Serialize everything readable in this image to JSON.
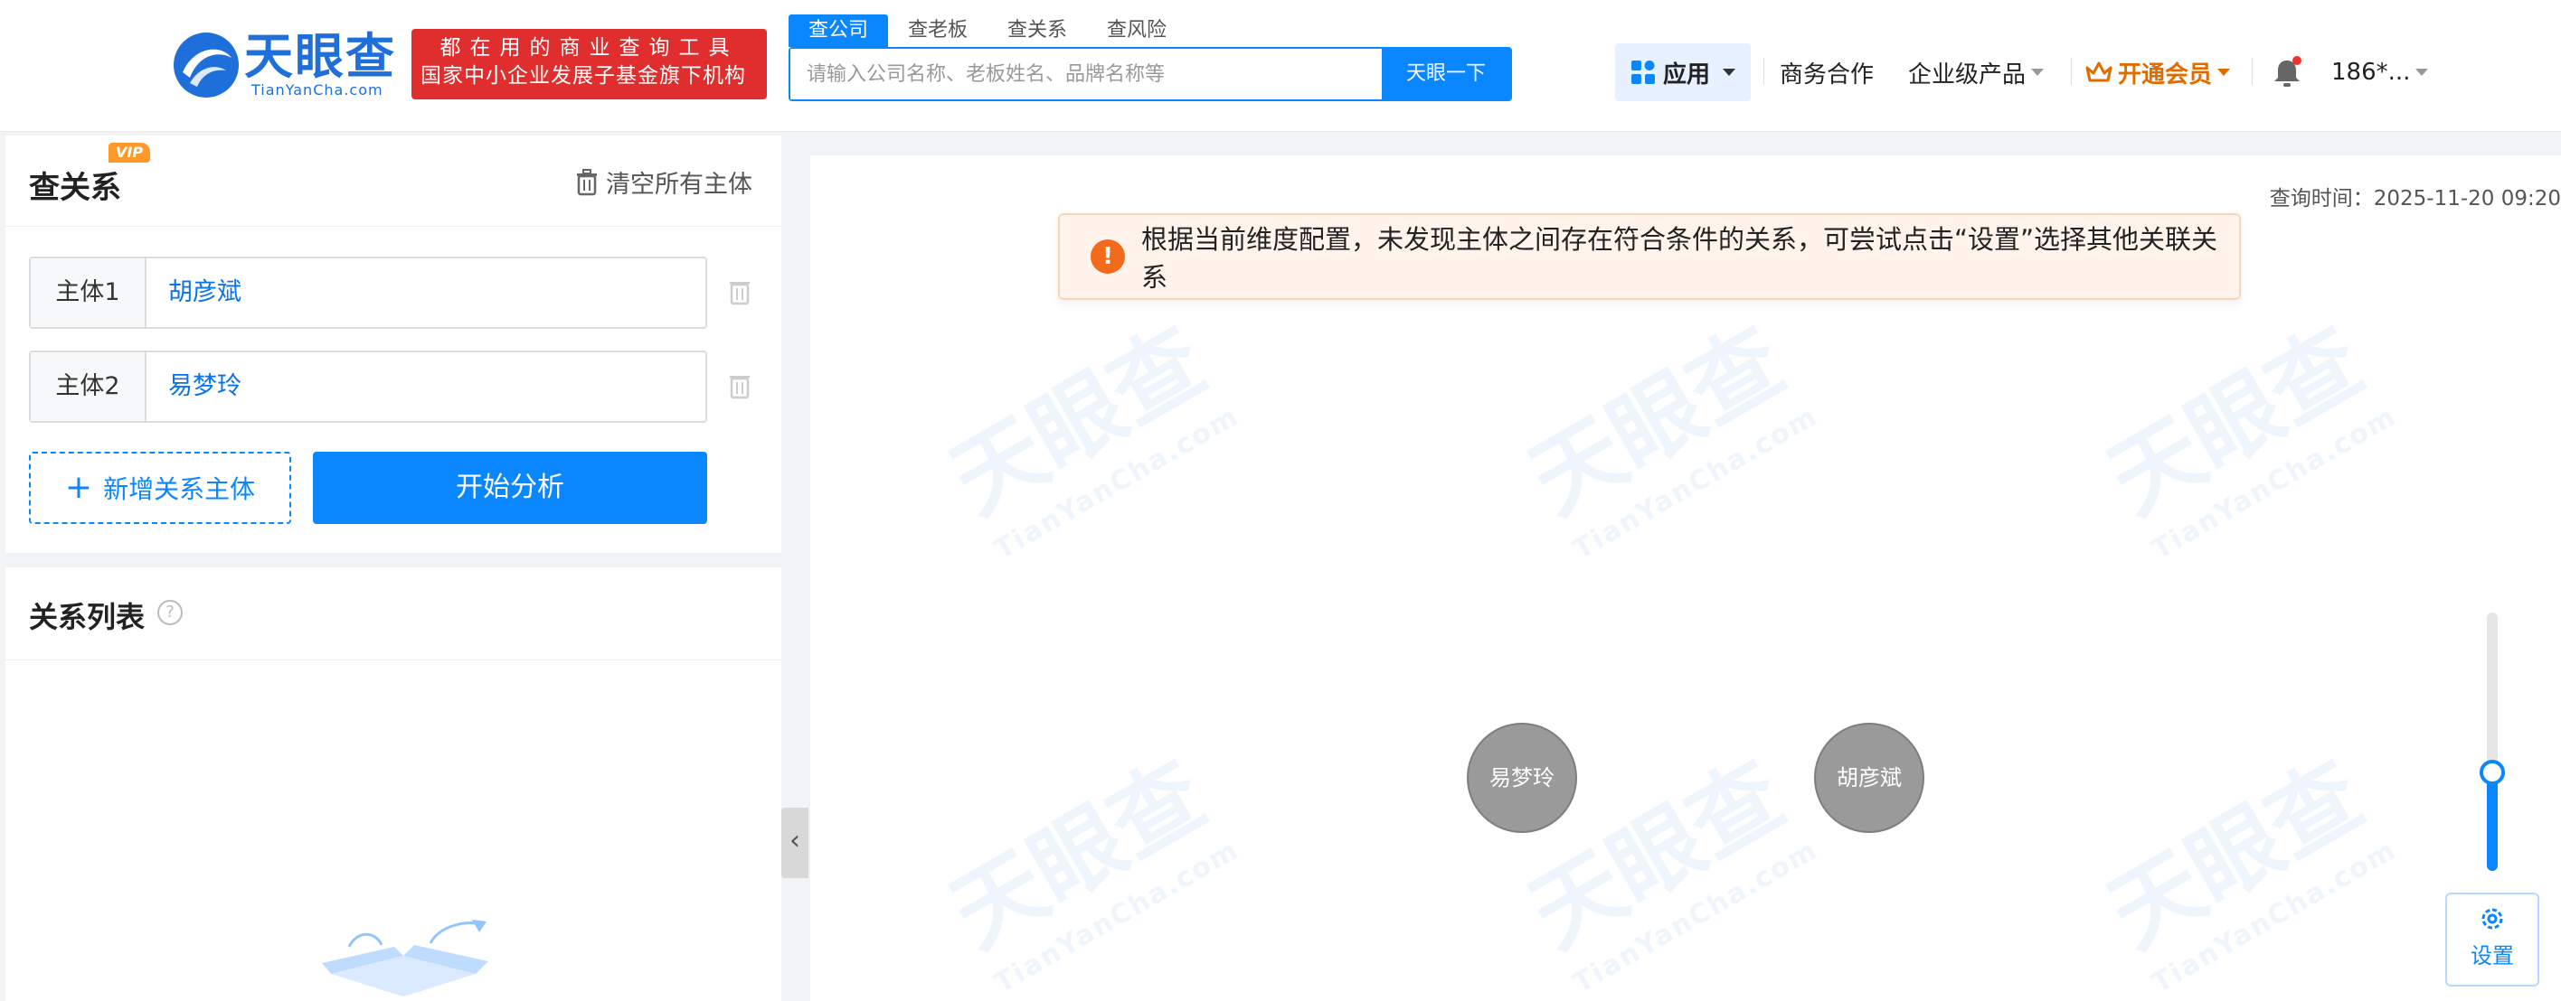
{
  "header": {
    "logo_text": "天眼查",
    "logo_sub": "TianYanCha.com",
    "slogan_line1": "都在用的商业查询工具",
    "slogan_line2": "国家中小企业发展子基金旗下机构",
    "search_tabs": [
      "查公司",
      "查老板",
      "查关系",
      "查风险"
    ],
    "search_placeholder": "请输入公司名称、老板姓名、品牌名称等",
    "search_button": "天眼一下",
    "nav": {
      "apps": "应用",
      "business": "商务合作",
      "enterprise": "企业级产品",
      "vip": "开通会员",
      "user": "186*..."
    }
  },
  "sidebar": {
    "title": "查关系",
    "vip_badge": "VIP",
    "clear_all": "清空所有主体",
    "entities": [
      {
        "label": "主体1",
        "value": "胡彦斌"
      },
      {
        "label": "主体2",
        "value": "易梦玲"
      }
    ],
    "add_button": "新增关系主体",
    "start_button": "开始分析",
    "list_title": "关系列表",
    "help_icon": "?"
  },
  "canvas": {
    "query_time": "查询时间：2025-11-20 09:20",
    "alert_text": "根据当前维度配置，未发现主体之间存在符合条件的关系，可尝试点击“设置”选择其他关联关系",
    "watermark": "天眼查",
    "watermark_sub": "TianYanCha.com",
    "nodes": [
      "易梦玲",
      "胡彦斌"
    ],
    "zoom_level": 0.38,
    "settings_label": "设置"
  },
  "colors": {
    "brand_blue": "#0a86ff",
    "slogan_red": "#e02d2d",
    "vip_orange": "#e06c00",
    "alert_orange": "#f26a1b",
    "node_grey": "#9a9a9a"
  },
  "icons": [
    "search-icon",
    "apps-grid-icon",
    "crown-icon",
    "bell-icon",
    "trash-icon",
    "plus-icon",
    "help-icon",
    "chevron-left-icon",
    "warning-icon",
    "gear-icon"
  ]
}
